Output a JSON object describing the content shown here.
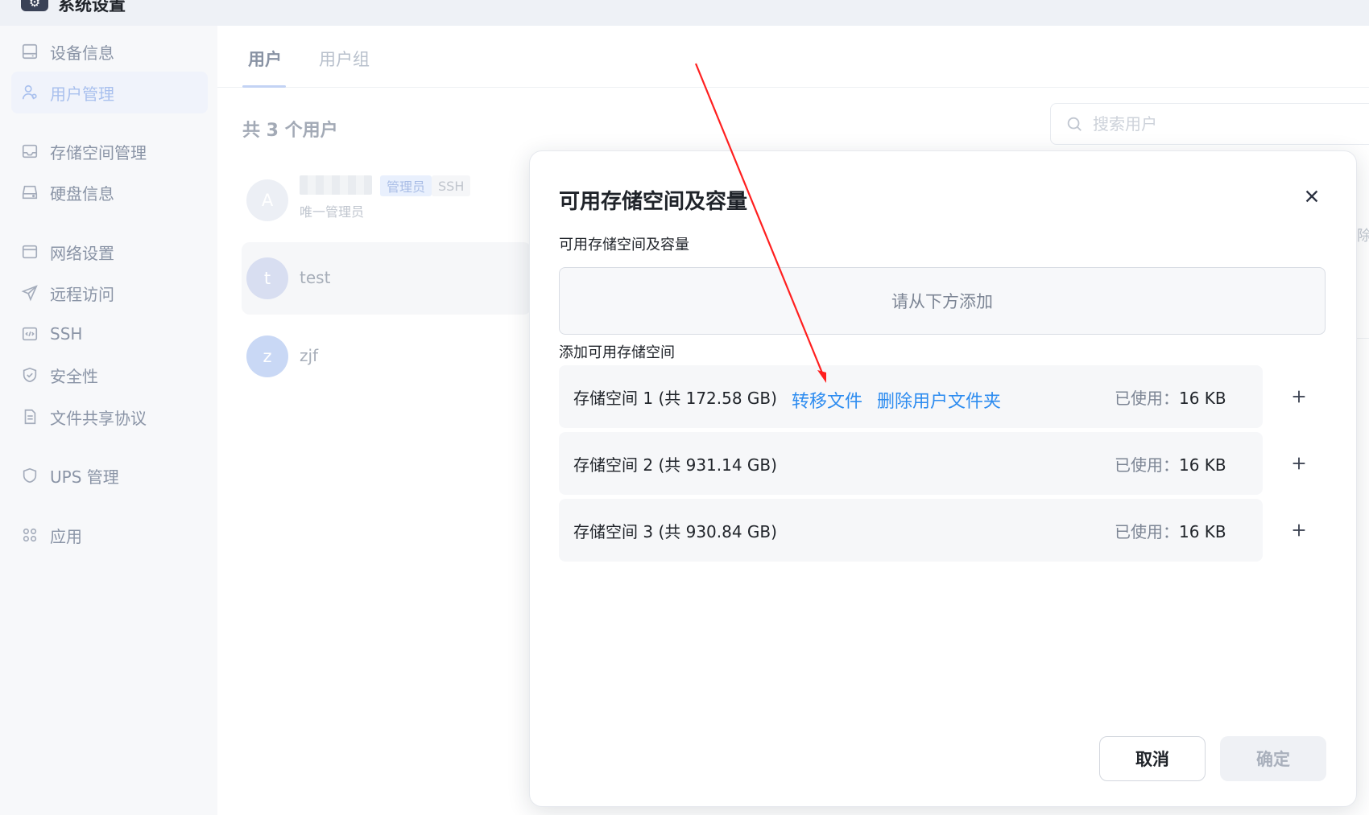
{
  "window": {
    "title": "系统设置",
    "icon": "gear-icon"
  },
  "sidebar": {
    "items": [
      {
        "label": "设备信息",
        "icon": "monitor-icon",
        "active": false
      },
      {
        "label": "用户管理",
        "icon": "user-icon",
        "active": true
      },
      {
        "label": "存储空间管理",
        "icon": "storage-icon",
        "active": false
      },
      {
        "label": "硬盘信息",
        "icon": "disk-icon",
        "active": false
      },
      {
        "label": "网络设置",
        "icon": "network-icon",
        "active": false
      },
      {
        "label": "远程访问",
        "icon": "send-icon",
        "active": false
      },
      {
        "label": "SSH",
        "icon": "code-icon",
        "active": false
      },
      {
        "label": "安全性",
        "icon": "shield-check-icon",
        "active": false
      },
      {
        "label": "文件共享协议",
        "icon": "document-icon",
        "active": false
      },
      {
        "label": "UPS 管理",
        "icon": "shield-icon",
        "active": false
      },
      {
        "label": "应用",
        "icon": "apps-icon",
        "active": false
      }
    ]
  },
  "main": {
    "tabs": [
      {
        "label": "用户",
        "active": true
      },
      {
        "label": "用户组",
        "active": false
      }
    ],
    "user_count": "共 3 个用户",
    "search": {
      "placeholder": "搜索用户"
    },
    "users": [
      {
        "avatar": "A",
        "name": "",
        "badges": [
          "管理员",
          "SSH"
        ],
        "subtitle": "唯一管理员"
      },
      {
        "avatar": "t",
        "name": "test"
      },
      {
        "avatar": "z",
        "name": "zjf"
      }
    ],
    "edge_char": "除"
  },
  "modal": {
    "title": "可用存储空间及容量",
    "section_available": "可用存储空间及容量",
    "dropzone_text": "请从下方添加",
    "section_add": "添加可用存储空间",
    "storage_items": [
      {
        "name": "存储空间 1 (共 172.58 GB)",
        "links": [
          "转移文件",
          "删除用户文件夹"
        ],
        "used_label": "已使用：",
        "used_value": "16 KB"
      },
      {
        "name": "存储空间 2 (共 931.14 GB)",
        "used_label": "已使用：",
        "used_value": "16 KB"
      },
      {
        "name": "存储空间 3 (共 930.84 GB)",
        "used_label": "已使用：",
        "used_value": "16 KB"
      }
    ],
    "cancel_label": "取消",
    "confirm_label": "确定"
  },
  "colors": {
    "link": "#2d8cf0",
    "annotation_arrow": "#ff1f1f",
    "sidebar_active": "#a9c0ee"
  }
}
